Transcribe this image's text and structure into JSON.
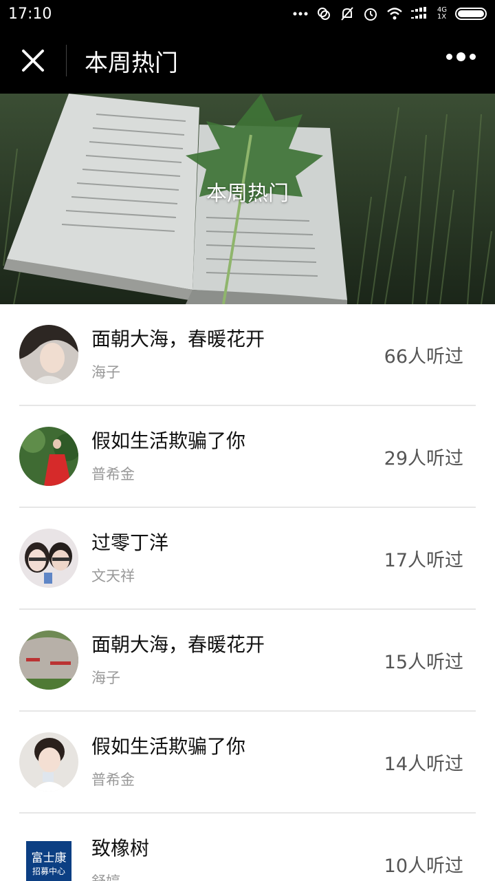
{
  "status_bar": {
    "time": "17:10",
    "network_top": "4G",
    "network_bottom": "1X"
  },
  "nav": {
    "title": "本周热门"
  },
  "banner": {
    "title": "本周热门"
  },
  "items": [
    {
      "title": "面朝大海，春暖花开",
      "author": "海子",
      "count": "66人听过"
    },
    {
      "title": "假如生活欺骗了你",
      "author": "普希金",
      "count": "29人听过"
    },
    {
      "title": "过零丁洋",
      "author": "文天祥",
      "count": "17人听过"
    },
    {
      "title": "面朝大海，春暖花开",
      "author": "海子",
      "count": "15人听过"
    },
    {
      "title": "假如生活欺骗了你",
      "author": "普希金",
      "count": "14人听过"
    },
    {
      "title": "致橡树",
      "author": "舒婷",
      "count": "10人听过",
      "avatar_text_1": "富士康",
      "avatar_text_2": "招募中心"
    }
  ]
}
